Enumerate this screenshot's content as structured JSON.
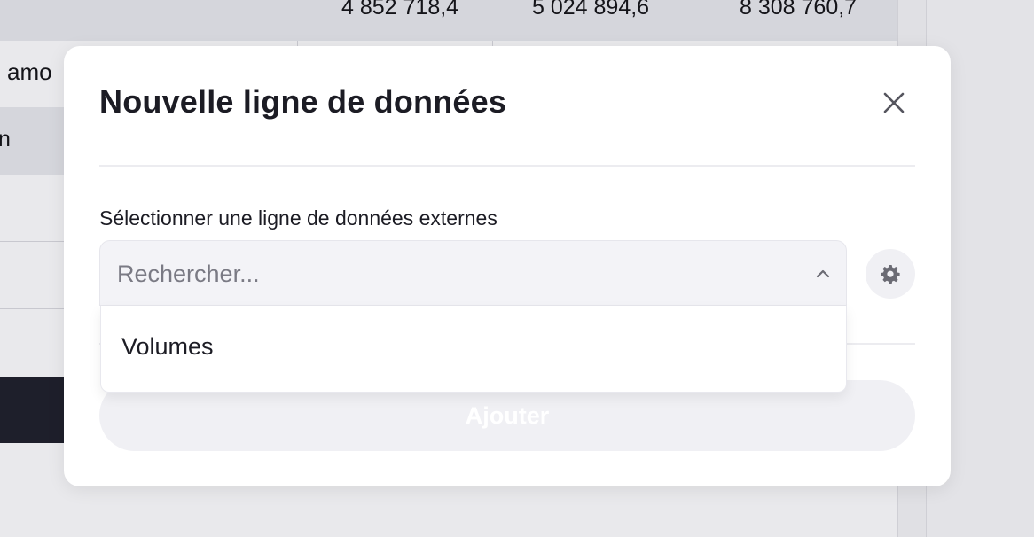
{
  "background": {
    "header_values": [
      "4 852 718,4",
      "5 024 894,6",
      "8 308 760,7"
    ],
    "row_label_partial": "amo",
    "row_label_n": "n"
  },
  "modal": {
    "title": "Nouvelle ligne de données",
    "field_label": "Sélectionner une ligne de données externes",
    "search_placeholder": "Rechercher...",
    "dropdown_options": [
      "Volumes"
    ],
    "add_button_label": "Ajouter"
  },
  "colors": {
    "title_text": "#1c1c24",
    "placeholder_text": "#7a7a84",
    "button_disabled_bg": "#f0f0f4"
  },
  "icons": {
    "close": "close-icon",
    "chevron": "chevron-up-icon",
    "settings": "gear-icon"
  }
}
